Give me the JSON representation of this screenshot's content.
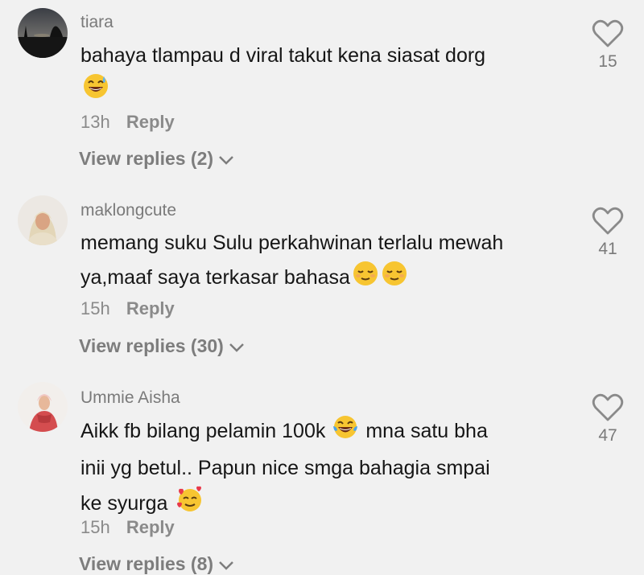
{
  "comments": [
    {
      "username": "tiara",
      "text": "bahaya tlampau d viral takut kena siasat dorg",
      "emoji": "sweat-smile-emoji",
      "time": "13h",
      "reply_label": "Reply",
      "view_replies": "View replies (2)",
      "likes": "15"
    },
    {
      "username": "maklongcute",
      "text_line1": "memang suku Sulu perkahwinan terlalu mewah",
      "text_line2": "ya,maaf saya terkasar bahasa",
      "emoji": "relieved-face-emoji",
      "time": "15h",
      "reply_label": "Reply",
      "view_replies": "View replies (30)",
      "likes": "41"
    },
    {
      "username": "Ummie Aisha",
      "text_part1": "Aikk fb bilang pelamin 100k",
      "text_part2": "mna satu bha",
      "text_line2": "inii yg betul.. Papun nice smga bahagia smpai",
      "text_line3": "ke syurga",
      "emoji1": "tears-of-joy-emoji",
      "emoji2": "smiling-face-with-hearts-emoji",
      "time": "15h",
      "reply_label": "Reply",
      "view_replies": "View replies (8)",
      "likes": "47"
    }
  ]
}
